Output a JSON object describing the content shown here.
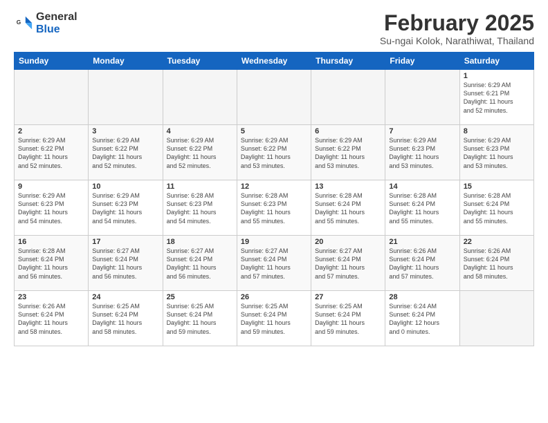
{
  "logo": {
    "general": "General",
    "blue": "Blue"
  },
  "title": "February 2025",
  "subtitle": "Su-ngai Kolok, Narathiwat, Thailand",
  "weekdays": [
    "Sunday",
    "Monday",
    "Tuesday",
    "Wednesday",
    "Thursday",
    "Friday",
    "Saturday"
  ],
  "weeks": [
    [
      {
        "day": "",
        "info": ""
      },
      {
        "day": "",
        "info": ""
      },
      {
        "day": "",
        "info": ""
      },
      {
        "day": "",
        "info": ""
      },
      {
        "day": "",
        "info": ""
      },
      {
        "day": "",
        "info": ""
      },
      {
        "day": "1",
        "info": "Sunrise: 6:29 AM\nSunset: 6:21 PM\nDaylight: 11 hours\nand 52 minutes."
      }
    ],
    [
      {
        "day": "2",
        "info": "Sunrise: 6:29 AM\nSunset: 6:22 PM\nDaylight: 11 hours\nand 52 minutes."
      },
      {
        "day": "3",
        "info": "Sunrise: 6:29 AM\nSunset: 6:22 PM\nDaylight: 11 hours\nand 52 minutes."
      },
      {
        "day": "4",
        "info": "Sunrise: 6:29 AM\nSunset: 6:22 PM\nDaylight: 11 hours\nand 52 minutes."
      },
      {
        "day": "5",
        "info": "Sunrise: 6:29 AM\nSunset: 6:22 PM\nDaylight: 11 hours\nand 53 minutes."
      },
      {
        "day": "6",
        "info": "Sunrise: 6:29 AM\nSunset: 6:22 PM\nDaylight: 11 hours\nand 53 minutes."
      },
      {
        "day": "7",
        "info": "Sunrise: 6:29 AM\nSunset: 6:23 PM\nDaylight: 11 hours\nand 53 minutes."
      },
      {
        "day": "8",
        "info": "Sunrise: 6:29 AM\nSunset: 6:23 PM\nDaylight: 11 hours\nand 53 minutes."
      }
    ],
    [
      {
        "day": "9",
        "info": "Sunrise: 6:29 AM\nSunset: 6:23 PM\nDaylight: 11 hours\nand 54 minutes."
      },
      {
        "day": "10",
        "info": "Sunrise: 6:29 AM\nSunset: 6:23 PM\nDaylight: 11 hours\nand 54 minutes."
      },
      {
        "day": "11",
        "info": "Sunrise: 6:28 AM\nSunset: 6:23 PM\nDaylight: 11 hours\nand 54 minutes."
      },
      {
        "day": "12",
        "info": "Sunrise: 6:28 AM\nSunset: 6:23 PM\nDaylight: 11 hours\nand 55 minutes."
      },
      {
        "day": "13",
        "info": "Sunrise: 6:28 AM\nSunset: 6:24 PM\nDaylight: 11 hours\nand 55 minutes."
      },
      {
        "day": "14",
        "info": "Sunrise: 6:28 AM\nSunset: 6:24 PM\nDaylight: 11 hours\nand 55 minutes."
      },
      {
        "day": "15",
        "info": "Sunrise: 6:28 AM\nSunset: 6:24 PM\nDaylight: 11 hours\nand 55 minutes."
      }
    ],
    [
      {
        "day": "16",
        "info": "Sunrise: 6:28 AM\nSunset: 6:24 PM\nDaylight: 11 hours\nand 56 minutes."
      },
      {
        "day": "17",
        "info": "Sunrise: 6:27 AM\nSunset: 6:24 PM\nDaylight: 11 hours\nand 56 minutes."
      },
      {
        "day": "18",
        "info": "Sunrise: 6:27 AM\nSunset: 6:24 PM\nDaylight: 11 hours\nand 56 minutes."
      },
      {
        "day": "19",
        "info": "Sunrise: 6:27 AM\nSunset: 6:24 PM\nDaylight: 11 hours\nand 57 minutes."
      },
      {
        "day": "20",
        "info": "Sunrise: 6:27 AM\nSunset: 6:24 PM\nDaylight: 11 hours\nand 57 minutes."
      },
      {
        "day": "21",
        "info": "Sunrise: 6:26 AM\nSunset: 6:24 PM\nDaylight: 11 hours\nand 57 minutes."
      },
      {
        "day": "22",
        "info": "Sunrise: 6:26 AM\nSunset: 6:24 PM\nDaylight: 11 hours\nand 58 minutes."
      }
    ],
    [
      {
        "day": "23",
        "info": "Sunrise: 6:26 AM\nSunset: 6:24 PM\nDaylight: 11 hours\nand 58 minutes."
      },
      {
        "day": "24",
        "info": "Sunrise: 6:25 AM\nSunset: 6:24 PM\nDaylight: 11 hours\nand 58 minutes."
      },
      {
        "day": "25",
        "info": "Sunrise: 6:25 AM\nSunset: 6:24 PM\nDaylight: 11 hours\nand 59 minutes."
      },
      {
        "day": "26",
        "info": "Sunrise: 6:25 AM\nSunset: 6:24 PM\nDaylight: 11 hours\nand 59 minutes."
      },
      {
        "day": "27",
        "info": "Sunrise: 6:25 AM\nSunset: 6:24 PM\nDaylight: 11 hours\nand 59 minutes."
      },
      {
        "day": "28",
        "info": "Sunrise: 6:24 AM\nSunset: 6:24 PM\nDaylight: 12 hours\nand 0 minutes."
      },
      {
        "day": "",
        "info": ""
      }
    ]
  ]
}
